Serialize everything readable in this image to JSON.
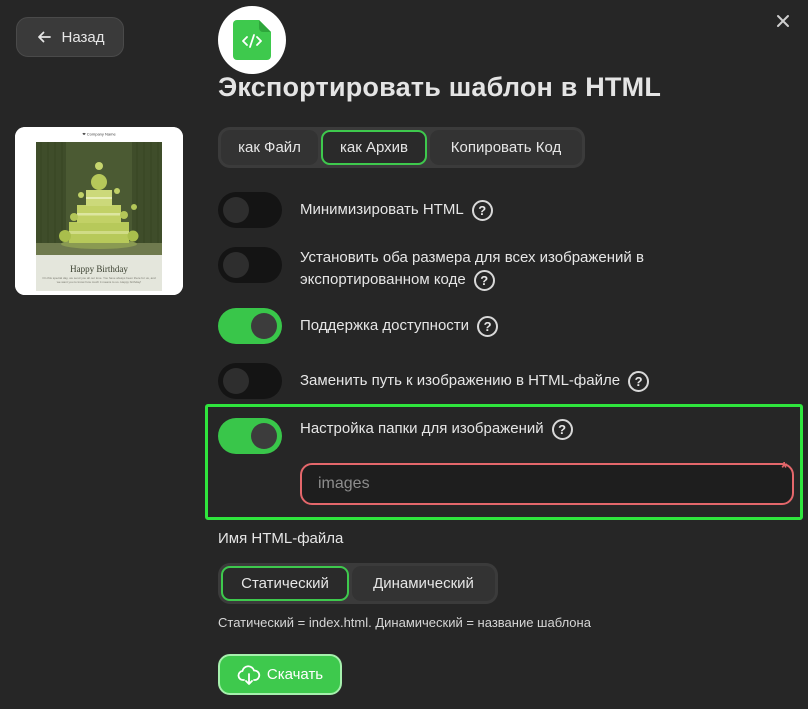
{
  "nav": {
    "back_label": "Назад"
  },
  "dialog": {
    "title": "Экспортировать шаблон в HTML"
  },
  "preview": {
    "header_text": "❤ Company Name",
    "card_title": "Happy Birthday",
    "body_text": "On this special day, we send you all our love. You have always been there for us, and we want you to know how much it means to us. Happy birthday!"
  },
  "export_mode": {
    "tabs": [
      {
        "label": "как Файл",
        "active": false
      },
      {
        "label": "как Архив",
        "active": true
      },
      {
        "label": "Копировать Код",
        "active": false
      }
    ]
  },
  "options": [
    {
      "label": "Минимизировать HTML",
      "on": false
    },
    {
      "label": "Установить оба размера для всех изображений в экспортированном коде",
      "on": false
    },
    {
      "label": "Поддержка доступности",
      "on": true
    },
    {
      "label": "Заменить путь к изображению в HTML-файле",
      "on": false
    },
    {
      "label": "Настройка папки для изображений",
      "on": true
    }
  ],
  "folder": {
    "value": "",
    "placeholder": "images",
    "required_mark": "*"
  },
  "filename": {
    "label": "Имя HTML-файла",
    "tabs": [
      {
        "label": "Статический",
        "active": true
      },
      {
        "label": "Динамический",
        "active": false
      }
    ],
    "hint": "Статический = index.html. Динамический = название шаблона"
  },
  "download": {
    "label": "Скачать"
  },
  "help_mark": "?",
  "colors": {
    "accent": "#3ec94d",
    "highlight": "#2fe53d",
    "error": "#e4676b",
    "background": "#262626"
  }
}
